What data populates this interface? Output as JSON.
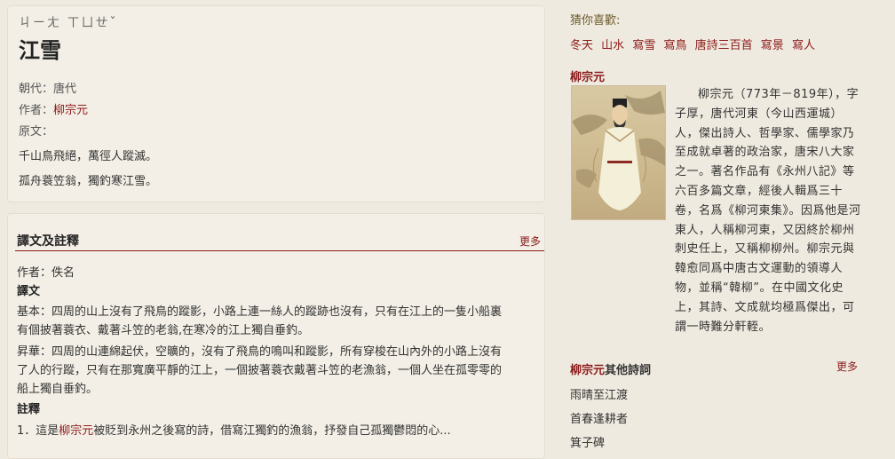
{
  "poem": {
    "pinyin": "ㄐㄧㄤ ㄒㄩㄝˇ",
    "title": "江雪",
    "dynasty_label": "朝代：",
    "dynasty": "唐代",
    "author_label": "作者：",
    "author": "柳宗元",
    "original_label": "原文：",
    "lines": [
      "千山鳥飛絕，萬徑人蹤滅。",
      "孤舟蓑笠翁，獨釣寒江雪。"
    ]
  },
  "translation": {
    "heading": "譯文及註釋",
    "more": "更多",
    "author_line": "作者：佚名",
    "subheading": "譯文",
    "p1_line1": "基本：四周的山上沒有了飛鳥的蹤影，小路上連一絲人的蹤跡也沒有，只有在江上的一隻小船裏",
    "p1_line2": "有個披著蓑衣、戴著斗笠的老翁,在寒冷的江上獨自垂釣。",
    "p2_line1": "昇華：四周的山連綿起伏，空曠的，沒有了飛鳥的鳴叫和蹤影，所有穿梭在山內外的小路上沒有",
    "p2_line2": "了人的行蹤，只有在那寬廣平靜的江上，一個披著蓑衣戴著斗笠的老漁翁，一個人坐在孤零零的",
    "p2_line3": "船上獨自垂釣。",
    "notes_heading": "註釋",
    "note_prefix": "1．這是",
    "note_link": "柳宗元",
    "note_suffix": "被貶到永州之後寫的詩，借寫江獨釣的漁翁，抒發自己孤獨鬱悶的心..."
  },
  "sidebar": {
    "guess_heading": "猜你喜歡:",
    "tags": [
      "冬天",
      "山水",
      "寫雪",
      "寫鳥",
      "唐詩三百首",
      "寫景",
      "寫人"
    ],
    "author_heading": "柳宗元",
    "bio": "柳宗元（773年－819年），字子厚，唐代河東（今山西運城）人，傑出詩人、哲學家、儒學家乃至成就卓著的政治家，唐宋八大家之一。著名作品有《永州八記》等六百多篇文章，經後人輯爲三十卷，名爲《柳河東集》。因爲他是河東人，人稱柳河東，又因終於柳州刺史任上，又稱柳柳州。柳宗元與韓愈同爲中唐古文運動的領導人物，並稱“韓柳”。在中國文化史上，其詩、文成就均極爲傑出，可謂一時難分軒輊。",
    "works_author": "柳宗元",
    "works_suffix": "其他詩詞",
    "works_more": "更多",
    "works": [
      "雨晴至江渡",
      "首春逢耕者",
      "箕子碑"
    ]
  }
}
